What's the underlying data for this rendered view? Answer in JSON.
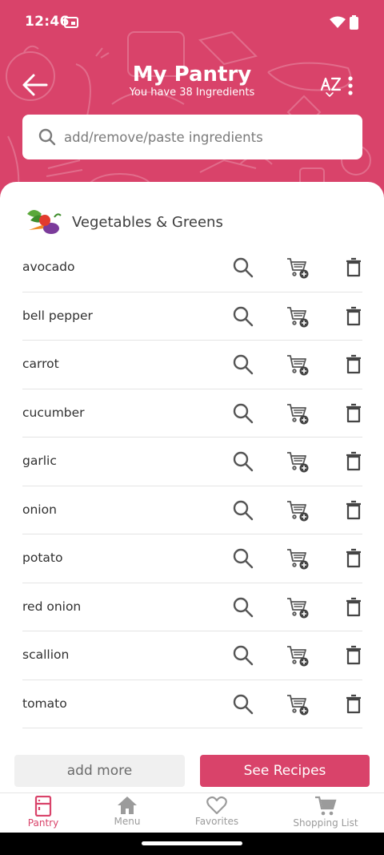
{
  "status_bar": {
    "time": "12:46"
  },
  "header": {
    "title": "My Pantry",
    "subtitle": "You have 38 Ingredients"
  },
  "search": {
    "placeholder": "add/remove/paste ingredients"
  },
  "category": {
    "title": "Vegetables & Greens"
  },
  "items": [
    {
      "name": "avocado"
    },
    {
      "name": "bell pepper"
    },
    {
      "name": "carrot"
    },
    {
      "name": "cucumber"
    },
    {
      "name": "garlic"
    },
    {
      "name": "onion"
    },
    {
      "name": "potato"
    },
    {
      "name": "red onion"
    },
    {
      "name": "scallion"
    },
    {
      "name": "tomato"
    }
  ],
  "actions": {
    "add_more": "add more",
    "see_recipes": "See Recipes"
  },
  "nav": [
    {
      "label": "Pantry",
      "icon": "fridge-icon",
      "active": true
    },
    {
      "label": "Menu",
      "icon": "home-icon",
      "active": false
    },
    {
      "label": "Favorites",
      "icon": "heart-icon",
      "active": false
    },
    {
      "label": "Shopping List",
      "icon": "cart-icon",
      "active": false
    }
  ],
  "colors": {
    "accent": "#d9436a",
    "text": "#2f2f2f",
    "icon": "#555555"
  }
}
